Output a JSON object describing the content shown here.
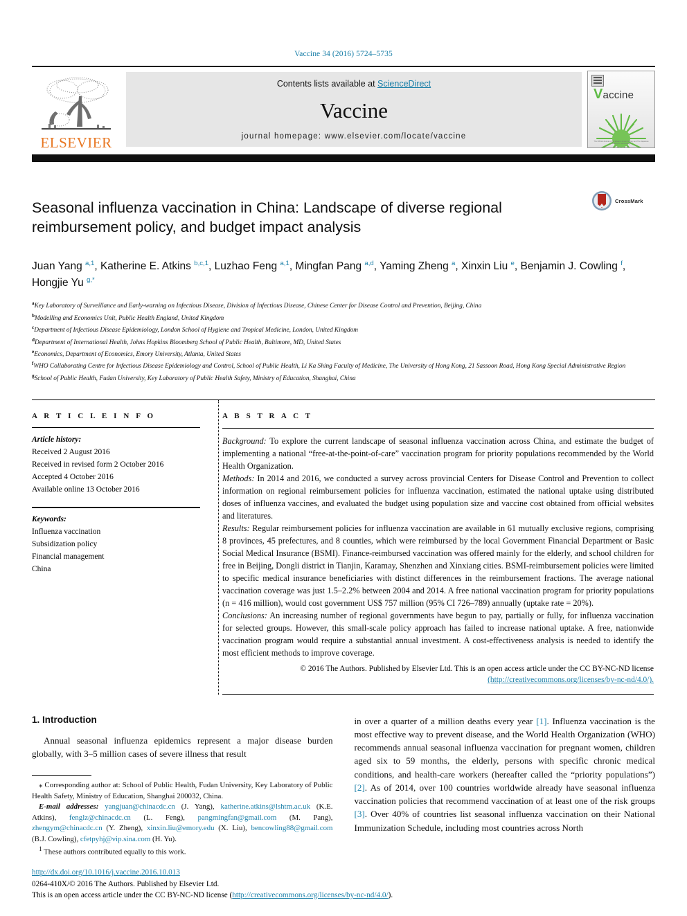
{
  "running_head": "Vaccine 34 (2016) 5724–5735",
  "masthead": {
    "publisher_logo_text": "ELSEVIER",
    "contents_prefix": "Contents lists available at ",
    "contents_link": "ScienceDirect",
    "journal_name": "Vaccine",
    "homepage_label": "journal homepage: www.elsevier.com/locate/vaccine",
    "cover": {
      "title_first_letter": "V",
      "title_rest": "accine",
      "footer_text": "The Official Journal of the Edward Jenner Society and The Japanese Society for Vaccinology"
    }
  },
  "article": {
    "title": "Seasonal influenza vaccination in China: Landscape of diverse regional reimbursement policy, and budget impact analysis",
    "crossmark_label": "CrossMark",
    "authors_html": "Juan Yang <sup>a,1</sup>, Katherine E. Atkins <sup>b,c,1</sup>, Luzhao Feng <sup>a,1</sup>, Mingfan Pang <sup>a,d</sup>, Yaming Zheng <sup>a</sup>, Xinxin Liu <sup>e</sup>, Benjamin J. Cowling <sup>f</sup>, Hongjie Yu <sup>g,*</sup>",
    "affiliations": [
      {
        "mark": "a",
        "text": "Key Laboratory of Surveillance and Early-warning on Infectious Disease, Division of Infectious Disease, Chinese Center for Disease Control and Prevention, Beijing, China"
      },
      {
        "mark": "b",
        "text": "Modelling and Economics Unit, Public Health England, United Kingdom"
      },
      {
        "mark": "c",
        "text": "Department of Infectious Disease Epidemiology, London School of Hygiene and Tropical Medicine, London, United Kingdom"
      },
      {
        "mark": "d",
        "text": "Department of International Health, Johns Hopkins Bloomberg School of Public Health, Baltimore, MD, United States"
      },
      {
        "mark": "e",
        "text": "Economics, Department of Economics, Emory University, Atlanta, United States"
      },
      {
        "mark": "f",
        "text": "WHO Collaborating Centre for Infectious Disease Epidemiology and Control, School of Public Health, Li Ka Shing Faculty of Medicine, The University of Hong Kong, 21 Sassoon Road, Hong Kong Special Administrative Region"
      },
      {
        "mark": "g",
        "text": "School of Public Health, Fudan University, Key Laboratory of Public Health Safety, Ministry of Education, Shanghai, China"
      }
    ]
  },
  "article_info": {
    "heading": "A R T I C L E   I N F O",
    "history_label": "Article history:",
    "history": [
      "Received 2 August 2016",
      "Received in revised form 2 October 2016",
      "Accepted 4 October 2016",
      "Available online 13 October 2016"
    ],
    "keywords_label": "Keywords:",
    "keywords": [
      "Influenza vaccination",
      "Subsidization policy",
      "Financial management",
      "China"
    ]
  },
  "abstract": {
    "heading": "A B S T R A C T",
    "sections": [
      {
        "label": "Background:",
        "text": " To explore the current landscape of seasonal influenza vaccination across China, and estimate the budget of implementing a national “free-at-the-point-of-care” vaccination program for priority populations recommended by the World Health Organization."
      },
      {
        "label": "Methods:",
        "text": " In 2014 and 2016, we conducted a survey across provincial Centers for Disease Control and Prevention to collect information on regional reimbursement policies for influenza vaccination, estimated the national uptake using distributed doses of influenza vaccines, and evaluated the budget using population size and vaccine cost obtained from official websites and literatures."
      },
      {
        "label": "Results:",
        "text": " Regular reimbursement policies for influenza vaccination are available in 61 mutually exclusive regions, comprising 8 provinces, 45 prefectures, and 8 counties, which were reimbursed by the local Government Financial Department or Basic Social Medical Insurance (BSMI). Finance-reimbursed vaccination was offered mainly for the elderly, and school children for free in Beijing, Dongli district in Tianjin, Karamay, Shenzhen and Xinxiang cities. BSMI-reimbursement policies were limited to specific medical insurance beneficiaries with distinct differences in the reimbursement fractions. The average national vaccination coverage was just 1.5–2.2% between 2004 and 2014. A free national vaccination program for priority populations (n = 416 million), would cost government US$ 757 million (95% CI 726–789) annually (uptake rate = 20%)."
      },
      {
        "label": "Conclusions:",
        "text": " An increasing number of regional governments have begun to pay, partially or fully, for influenza vaccination for selected groups. However, this small-scale policy approach has failed to increase national uptake. A free, nationwide vaccination program would require a substantial annual investment. A cost-effectiveness analysis is needed to identify the most efficient methods to improve coverage."
      }
    ],
    "copyright_text": "© 2016 The Authors. Published by Elsevier Ltd. This is an open access article under the CC BY-NC-ND license",
    "license_url": "(http://creativecommons.org/licenses/by-nc-nd/4.0/)."
  },
  "body": {
    "section_number_title": "1. Introduction",
    "left_paragraph": "Annual seasonal influenza epidemics represent a major disease burden globally, with 3–5 million cases of severe illness that result",
    "right_column_html": "in over a quarter of a million deaths every year <span class=\"ref\">[1]</span>. Influenza vaccination is the most effective way to prevent disease, and the World Health Organization (WHO) recommends annual seasonal influenza vaccination for pregnant women, children aged six to 59 months, the elderly, persons with specific chronic medical conditions, and health-care workers (hereafter called the “priority populations”) <span class=\"ref\">[2]</span>. As of 2014, over 100 countries worldwide already have seasonal influenza vaccination policies that recommend vaccination of at least one of the risk groups <span class=\"ref\">[3]</span>. Over 40% of countries list seasonal influenza vaccination on their National Immunization Schedule, including most countries across North"
  },
  "footnotes": {
    "corresponding_html": "<span class=\"fn-indent\"></span>⁎ Corresponding author at: School of Public Health, Fudan University, Key Laboratory of Public Health Safety, Ministry of Education, Shanghai 200032, China.",
    "emails_html": "<span class=\"fn-indent\"></span><i>E-mail addresses:</i> <span class=\"mail\">yangjuan@chinacdc.cn</span> (J. Yang), <span class=\"mail\">katherine.atkins@lshtm.ac.uk</span> (K.E. Atkins), <span class=\"mail\">fenglz@chinacdc.cn</span> (L. Feng), <span class=\"mail\">pangmingfan@gmail.com</span> (M. Pang), <span class=\"mail\">zhengym@chinacdc.cn</span> (Y. Zheng), <span class=\"mail\">xinxin.liu@emory.edu</span> (X. Liu), <span class=\"mail\">bencowling88@gmail.com</span> (B.J. Cowling), <span class=\"mail\">cfetpyhj@vip.sina.com</span> (H. Yu).",
    "equal_contrib_html": "<span class=\"fn-indent\"></span><sup>1</sup> These authors contributed equally to this work."
  },
  "doi_block": {
    "doi_url": "http://dx.doi.org/10.1016/j.vaccine.2016.10.013",
    "issn_line": "0264-410X/© 2016 The Authors. Published by Elsevier Ltd.",
    "license_prefix": "This is an open access article under the CC BY-NC-ND license (",
    "license_url": "http://creativecommons.org/licenses/by-nc-nd/4.0/",
    "license_suffix": ")."
  },
  "colors": {
    "link_blue": "#1a7fa8",
    "elsevier_orange": "#E87722",
    "cover_green": "#5fbb46",
    "crossmark_red": "#b3261e"
  }
}
